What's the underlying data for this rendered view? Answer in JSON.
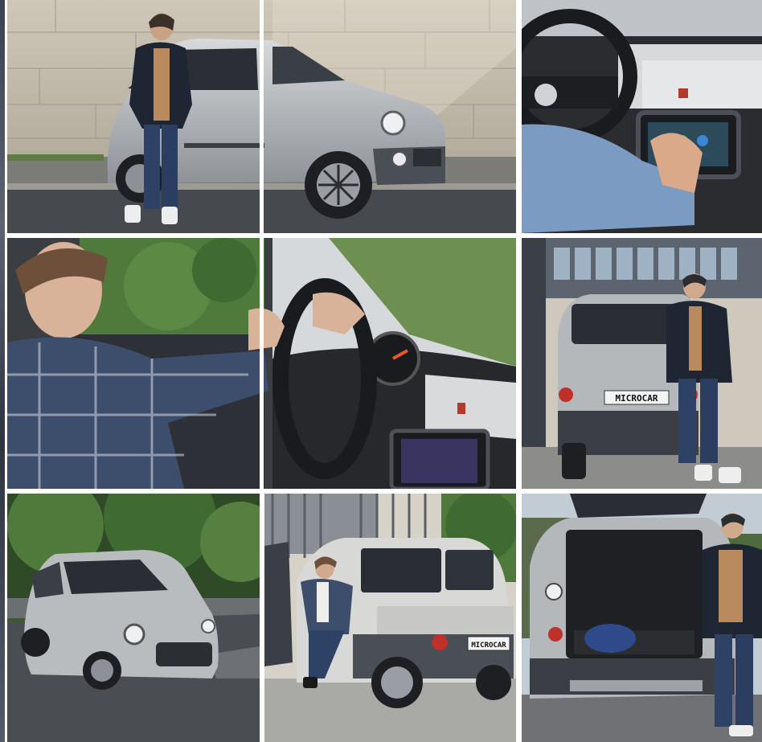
{
  "gallery": {
    "tiles": [
      {
        "plate": ""
      },
      {
        "plate": ""
      },
      {
        "plate": ""
      },
      {
        "plate": ""
      },
      {
        "plate": ""
      },
      {
        "plate": "MICROCAR"
      },
      {
        "plate": ""
      },
      {
        "plate": "MICROCAR"
      },
      {
        "plate": ""
      }
    ]
  },
  "colors": {
    "car_silver": "#b9bcbf",
    "car_dark": "#3b3f45",
    "stone_wall": "#b8b1a3",
    "road": "#4a4d52",
    "foliage": "#4f7a3b",
    "jacket_navy": "#1f2633",
    "hoodie_tan": "#b98a5e",
    "plaid_blue": "#3c4e6b",
    "denim": "#7c9bc2"
  }
}
